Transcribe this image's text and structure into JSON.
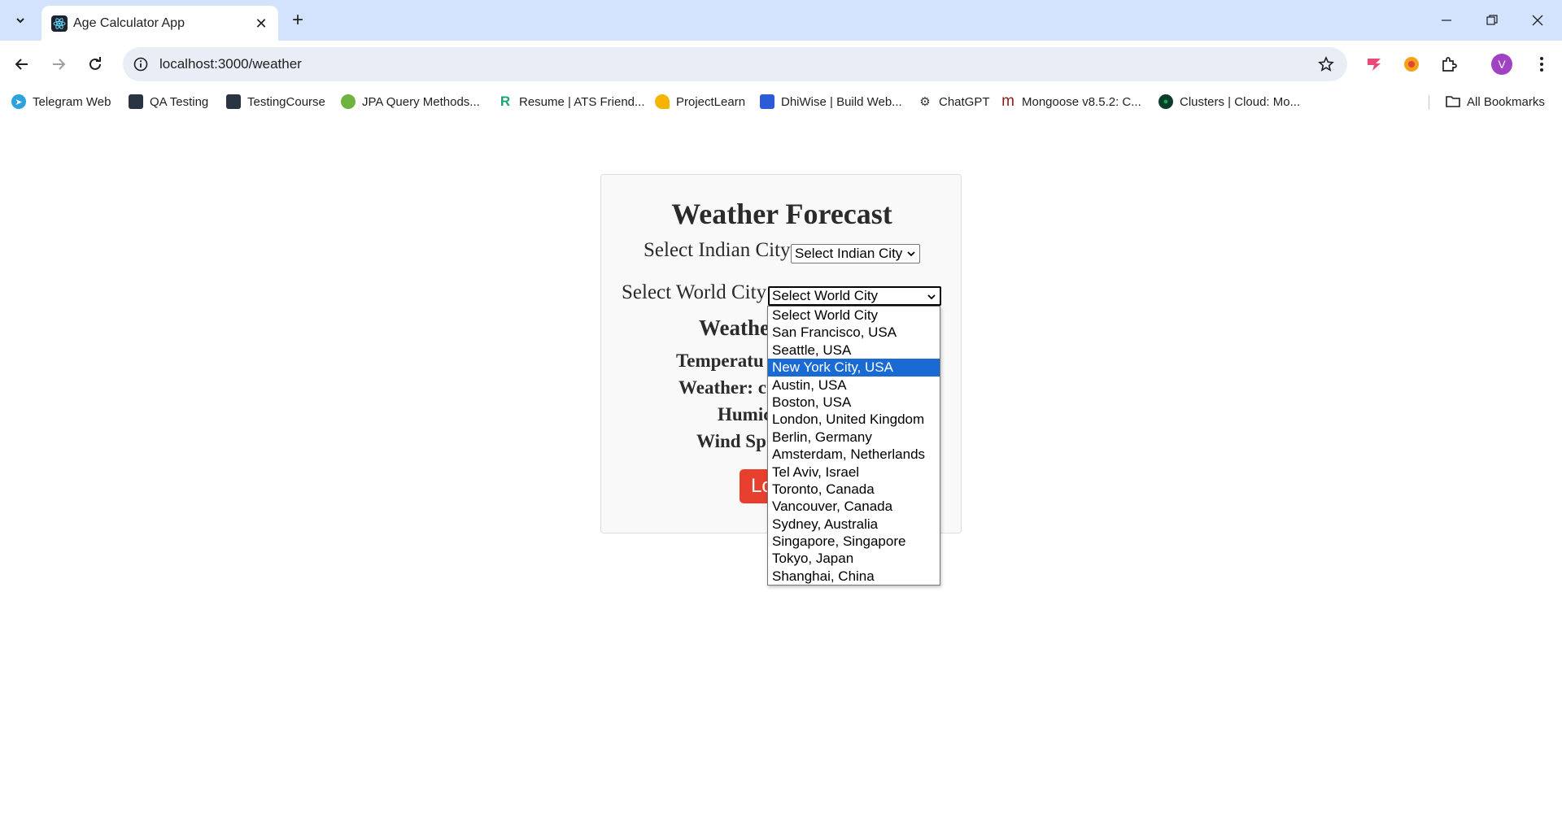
{
  "browser": {
    "tab_title": "Age Calculator App",
    "url": "localhost:3000/weather",
    "profile_initial": "V",
    "bookmarks": [
      {
        "label": "Telegram Web",
        "icon": "telegram-icon",
        "color": "#2aa3df"
      },
      {
        "label": "QA Testing",
        "icon": "qa-testing-icon",
        "color": "#2b3442"
      },
      {
        "label": "TestingCourse",
        "icon": "testing-course-icon",
        "color": "#2b3442"
      },
      {
        "label": "JPA Query Methods...",
        "icon": "spring-icon",
        "color": "#6db33f"
      },
      {
        "label": "Resume | ATS Friend...",
        "icon": "resume-icon",
        "color": "#1aa37a"
      },
      {
        "label": "ProjectLearn",
        "icon": "projectlearn-icon",
        "color": "#f4b400"
      },
      {
        "label": "DhiWise | Build Web...",
        "icon": "dhiwise-icon",
        "color": "#2d5bd8"
      },
      {
        "label": "ChatGPT",
        "icon": "chatgpt-icon",
        "color": "#333333"
      },
      {
        "label": "Mongoose v8.5.2: C...",
        "icon": "mongoose-icon",
        "color": "#8a1c1c"
      },
      {
        "label": "Clusters | Cloud: Mo...",
        "icon": "mongodb-icon",
        "color": "#13aa52"
      }
    ],
    "all_bookmarks_label": "All Bookmarks"
  },
  "page": {
    "title": "Weather Forecast",
    "indian_city_label": "Select Indian City",
    "indian_city_value": "Select Indian City",
    "world_city_label": "Select World City",
    "world_city_value": "Select World City",
    "weather_heading_partial": "Weathe",
    "temperature_partial": "Temperatu",
    "weather_partial": "Weather: c",
    "humidity_partial": "Humic",
    "wind_speed_partial": "Wind Sp",
    "button_partial": "Lo"
  },
  "world_city_options": [
    "Select World City",
    "San Francisco, USA",
    "Seattle, USA",
    "New York City, USA",
    "Austin, USA",
    "Boston, USA",
    "London, United Kingdom",
    "Berlin, Germany",
    "Amsterdam, Netherlands",
    "Tel Aviv, Israel",
    "Toronto, Canada",
    "Vancouver, Canada",
    "Sydney, Australia",
    "Singapore, Singapore",
    "Tokyo, Japan",
    "Shanghai, China"
  ],
  "highlighted_option_index": 3,
  "colors": {
    "tabbar": "#d3e3fd",
    "highlight": "#1a6ad3",
    "button": "#e8402f"
  }
}
